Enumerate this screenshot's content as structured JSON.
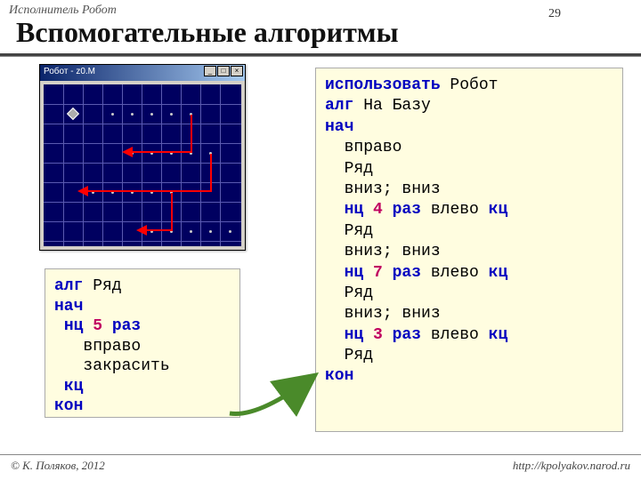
{
  "breadcrumb": "Исполнитель Робот",
  "title": "Вспомогательные алгоритмы",
  "page_num": "29",
  "robot_window": {
    "title": "Робот - z0.M"
  },
  "small_code": {
    "l1_kw": "алг",
    "l1_name": " Ряд",
    "l2": "нач",
    "l3_kw": "нц ",
    "l3_num": "5",
    "l3_rest": " раз",
    "l4": "вправо",
    "l5": "закрасить",
    "l6": "кц",
    "l7": "кон"
  },
  "big_code": {
    "l1_kw": "использовать",
    "l1_name": " Робот",
    "l2_kw": "алг",
    "l2_name": " На Базу",
    "l3": "нач",
    "l4": "вправо",
    "l5": "Ряд",
    "l6": "вниз; вниз",
    "l7_kw1": "нц ",
    "l7_num": "4",
    "l7_kw2": " раз ",
    "l7_cmd": "влево ",
    "l7_kw3": "кц",
    "l8": "Ряд",
    "l9": "вниз; вниз",
    "l10_kw1": "нц ",
    "l10_num": "7",
    "l10_kw2": " раз ",
    "l10_cmd": "влево ",
    "l10_kw3": "кц",
    "l11": "Ряд",
    "l12": "вниз; вниз",
    "l13_kw1": "нц ",
    "l13_num": "3",
    "l13_kw2": " раз ",
    "l13_cmd": "влево ",
    "l13_kw3": "кц",
    "l14": "Ряд",
    "l15": "кон"
  },
  "footer": {
    "left": "© К. Поляков, 2012",
    "right": "http://kpolyakov.narod.ru"
  }
}
